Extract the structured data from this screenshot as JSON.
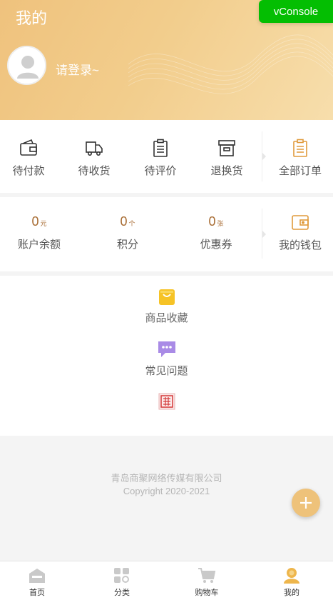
{
  "header": {
    "title": "我的",
    "login_prompt": "请登录~"
  },
  "vconsole": {
    "label": "vConsole"
  },
  "orders": [
    {
      "label": "待付款",
      "icon": "wallet-icon"
    },
    {
      "label": "待收货",
      "icon": "truck-icon"
    },
    {
      "label": "待评价",
      "icon": "clipboard-icon"
    },
    {
      "label": "退换货",
      "icon": "archive-box-icon"
    },
    {
      "label": "全部订单",
      "icon": "order-list-icon"
    }
  ],
  "wallet": {
    "balance": {
      "value": "0",
      "unit": "元",
      "label": "账户余额"
    },
    "points": {
      "value": "0",
      "unit": "个",
      "label": "积分"
    },
    "coupons": {
      "value": "0",
      "unit": "张",
      "label": "优惠券"
    },
    "my_wallet": {
      "label": "我的钱包",
      "icon": "purse-icon"
    }
  },
  "services": [
    {
      "label": "商品收藏",
      "icon": "shopping-bag-icon"
    },
    {
      "label": "常见问题",
      "icon": "chat-bubble-icon"
    }
  ],
  "footer": {
    "company": "青岛商聚网络传媒有限公司",
    "copyright": "Copyright 2020-2021"
  },
  "tabbar": [
    {
      "label": "首页",
      "icon": "home-icon"
    },
    {
      "label": "分类",
      "icon": "category-icon"
    },
    {
      "label": "购物车",
      "icon": "cart-icon"
    },
    {
      "label": "我的",
      "icon": "user-icon"
    }
  ],
  "colors": {
    "accent": "#efc27d",
    "brown": "#a86c33",
    "orange_icon": "#e09a3b",
    "vconsole": "#04be02"
  }
}
